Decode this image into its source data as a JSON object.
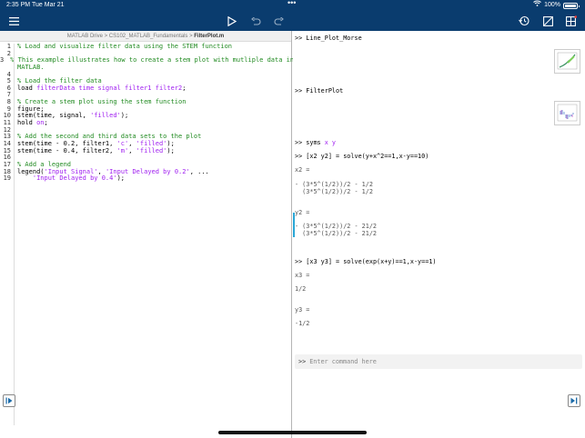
{
  "status": {
    "time": "2:35 PM",
    "date": "Tue Mar 21",
    "battery": "100%"
  },
  "toolbar": {
    "menu_icon": "menu-icon",
    "run_icon": "play-icon",
    "undo_icon": "undo-icon",
    "redo_icon": "redo-icon",
    "history_icon": "history-icon",
    "clear_icon": "clear-icon",
    "layout_icon": "layout-icon",
    "accent": "#0a3c6e"
  },
  "breadcrumb": {
    "path": "MATLAB Drive > CS102_MATLAB_Fundamentals > ",
    "file": "FilterPlot.m"
  },
  "code": [
    {
      "n": "1",
      "parts": [
        {
          "c": "cm",
          "t": "% Load and visualize filter data using the STEM function"
        }
      ]
    },
    {
      "n": "2",
      "parts": []
    },
    {
      "n": "3",
      "parts": [
        {
          "c": "cm",
          "t": "% This example illustrates how to create a stem plot with mutliple data in"
        }
      ]
    },
    {
      "n": "",
      "parts": [
        {
          "c": "cm",
          "t": "MATLAB."
        }
      ]
    },
    {
      "n": "4",
      "parts": []
    },
    {
      "n": "5",
      "parts": [
        {
          "c": "cm",
          "t": "% Load the filter data"
        }
      ]
    },
    {
      "n": "6",
      "parts": [
        {
          "c": "",
          "t": "load "
        },
        {
          "c": "st",
          "t": "filterData time signal filter1 filter2"
        },
        {
          "c": "",
          "t": ";"
        }
      ]
    },
    {
      "n": "7",
      "parts": []
    },
    {
      "n": "8",
      "parts": [
        {
          "c": "cm",
          "t": "% Create a stem plot using the stem function"
        }
      ]
    },
    {
      "n": "9",
      "parts": [
        {
          "c": "",
          "t": "figure;"
        }
      ]
    },
    {
      "n": "10",
      "parts": [
        {
          "c": "",
          "t": "stem(time, signal, "
        },
        {
          "c": "st",
          "t": "'filled'"
        },
        {
          "c": "",
          "t": ");"
        }
      ]
    },
    {
      "n": "11",
      "parts": [
        {
          "c": "",
          "t": "hold "
        },
        {
          "c": "st",
          "t": "on"
        },
        {
          "c": "",
          "t": ";"
        }
      ]
    },
    {
      "n": "12",
      "parts": []
    },
    {
      "n": "13",
      "parts": [
        {
          "c": "cm",
          "t": "% Add the second and third data sets to the plot"
        }
      ]
    },
    {
      "n": "14",
      "parts": [
        {
          "c": "",
          "t": "stem(time - 0.2, filter1, "
        },
        {
          "c": "st",
          "t": "'c'"
        },
        {
          "c": "",
          "t": ", "
        },
        {
          "c": "st",
          "t": "'filled'"
        },
        {
          "c": "",
          "t": ");"
        }
      ]
    },
    {
      "n": "15",
      "parts": [
        {
          "c": "",
          "t": "stem(time - 0.4, filter2, "
        },
        {
          "c": "st",
          "t": "'m'"
        },
        {
          "c": "",
          "t": ", "
        },
        {
          "c": "st",
          "t": "'filled'"
        },
        {
          "c": "",
          "t": ");"
        }
      ]
    },
    {
      "n": "16",
      "parts": []
    },
    {
      "n": "17",
      "parts": [
        {
          "c": "cm",
          "t": "% Add a legend"
        }
      ]
    },
    {
      "n": "18",
      "parts": [
        {
          "c": "",
          "t": "legend("
        },
        {
          "c": "st",
          "t": "'Input Signal'"
        },
        {
          "c": "",
          "t": ", "
        },
        {
          "c": "st",
          "t": "'Input Delayed by 0.2'"
        },
        {
          "c": "",
          "t": ", ..."
        }
      ]
    },
    {
      "n": "19",
      "parts": [
        {
          "c": "",
          "t": "    "
        },
        {
          "c": "st",
          "t": "'Input Delayed by 0.4'"
        },
        {
          "c": "",
          "t": ");"
        }
      ]
    }
  ],
  "command_window": {
    "entries": [
      {
        "prompt": ">> ",
        "text": "Line_Plot_Morse"
      },
      {
        "prompt": ">> ",
        "text": "FilterPlot"
      },
      {
        "prompt": ">> ",
        "text": "syms ",
        "var": "x y"
      },
      {
        "prompt": ">> ",
        "text": "[x2 y2] = solve(y+x^2==1,x-y==10)"
      },
      {
        "text": "x2 ="
      },
      {
        "text": "- (3*5^(1/2))/2 - 1/2"
      },
      {
        "text": "  (3*5^(1/2))/2 - 1/2"
      },
      {
        "text": "y2 ="
      },
      {
        "text": "- (3*5^(1/2))/2 - 21/2"
      },
      {
        "text": "  (3*5^(1/2))/2 - 21/2"
      },
      {
        "prompt": ">> ",
        "text": "[x3 y3] = solve(exp(x+y)==1,x-y==1)"
      },
      {
        "text": "x3 ="
      },
      {
        "text": "1/2"
      },
      {
        "text": "y3 ="
      },
      {
        "text": "-1/2"
      }
    ],
    "input_prompt": ">>",
    "input_placeholder": "Enter command here"
  }
}
